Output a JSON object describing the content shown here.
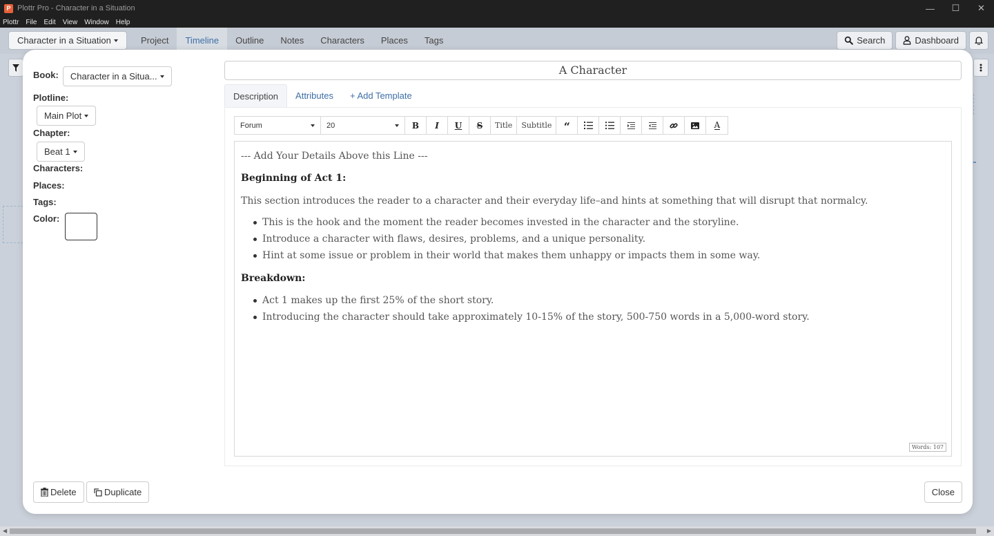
{
  "window": {
    "title": "Plottr Pro - Character in a Situation",
    "logo_letter": "P",
    "controls": {
      "minimize": "—",
      "maximize": "☐",
      "close": "✕"
    }
  },
  "menubar": {
    "items": [
      "Plottr",
      "File",
      "Edit",
      "View",
      "Window",
      "Help"
    ]
  },
  "navbar": {
    "book_selector": "Character in a Situation",
    "tabs": [
      {
        "label": "Project",
        "active": false
      },
      {
        "label": "Timeline",
        "active": true
      },
      {
        "label": "Outline",
        "active": false
      },
      {
        "label": "Notes",
        "active": false
      },
      {
        "label": "Characters",
        "active": false
      },
      {
        "label": "Places",
        "active": false
      },
      {
        "label": "Tags",
        "active": false
      }
    ],
    "search_label": "Search",
    "dashboard_label": "Dashboard"
  },
  "details": {
    "book_label": "Book:",
    "book_value": "Character in a Situa...",
    "plotline_label": "Plotline:",
    "plotline_value": "Main Plot",
    "chapter_label": "Chapter:",
    "chapter_value": "Beat 1",
    "characters_label": "Characters:",
    "places_label": "Places:",
    "tags_label": "Tags:",
    "color_label": "Color:"
  },
  "card": {
    "name": "A Character",
    "tabs": [
      {
        "label": "Description",
        "active": true
      },
      {
        "label": "Attributes",
        "active": false
      },
      {
        "label": "+ Add Template",
        "active": false
      }
    ]
  },
  "toolbar": {
    "font": "Forum",
    "size": "20",
    "title_label": "Title",
    "subtitle_label": "Subtitle"
  },
  "editor": {
    "separator": "--- Add Your Details Above this Line ---",
    "heading1": "Beginning of Act 1:",
    "intro": "This section introduces the reader to a character and their everyday life–and hints at something that will disrupt that normalcy.",
    "list1": [
      "This is the hook and the moment the reader becomes invested in the character and the storyline.",
      "Introduce a character with flaws, desires, problems, and a unique personality.",
      "Hint at some issue or problem in their world that makes them unhappy or impacts them in some way."
    ],
    "heading2": "Breakdown:",
    "list2": [
      "Act 1 makes up the first 25% of the short story.",
      "Introducing the character should take approximately 10-15% of the story, 500-750 words in a 5,000-word story."
    ],
    "word_count": "Words: 107"
  },
  "footer": {
    "delete_label": "Delete",
    "duplicate_label": "Duplicate",
    "close_label": "Close"
  }
}
